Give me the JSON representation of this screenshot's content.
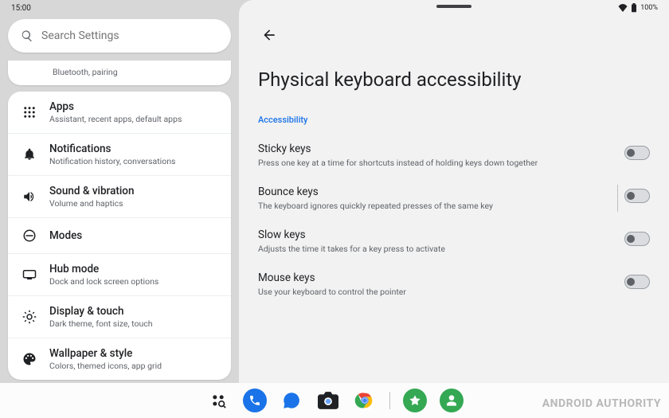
{
  "statusbar": {
    "time": "15:00",
    "battery": "100%"
  },
  "search": {
    "placeholder": "Search Settings"
  },
  "sidebar": {
    "stub_subtitle": "Bluetooth, pairing",
    "items": [
      {
        "title": "Apps",
        "subtitle": "Assistant, recent apps, default apps"
      },
      {
        "title": "Notifications",
        "subtitle": "Notification history, conversations"
      },
      {
        "title": "Sound & vibration",
        "subtitle": "Volume and haptics"
      },
      {
        "title": "Modes",
        "subtitle": ""
      },
      {
        "title": "Hub mode",
        "subtitle": "Dock and lock screen options"
      },
      {
        "title": "Display & touch",
        "subtitle": "Dark theme, font size, touch"
      },
      {
        "title": "Wallpaper & style",
        "subtitle": "Colors, themed icons, app grid"
      }
    ]
  },
  "detail": {
    "title": "Physical keyboard accessibility",
    "section": "Accessibility",
    "options": [
      {
        "title": "Sticky keys",
        "subtitle": "Press one key at a time for shortcuts instead of holding keys down together",
        "on": false
      },
      {
        "title": "Bounce keys",
        "subtitle": "The keyboard ignores quickly repeated presses of the same key",
        "on": false
      },
      {
        "title": "Slow keys",
        "subtitle": "Adjusts the time it takes for a key press to activate",
        "on": false
      },
      {
        "title": "Mouse keys",
        "subtitle": "Use your keyboard to control the pointer",
        "on": false
      }
    ]
  },
  "watermark": "ANDROID AUTHORITY"
}
